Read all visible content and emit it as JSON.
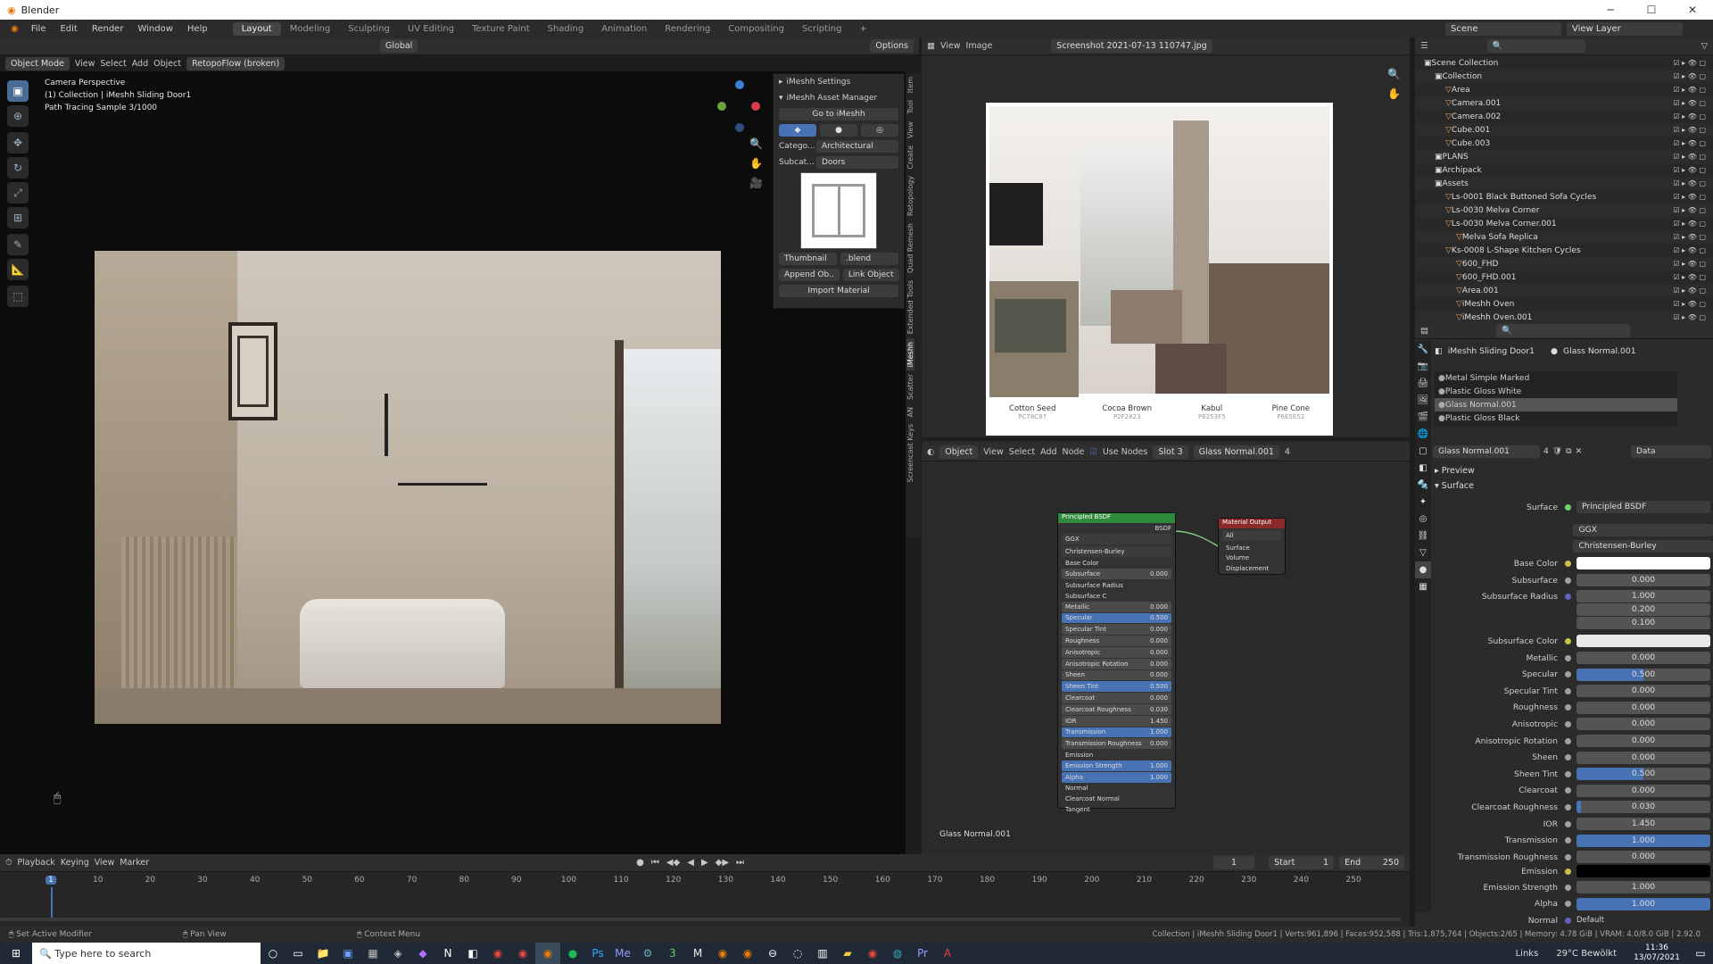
{
  "window": {
    "title": "Blender"
  },
  "menu": {
    "items": [
      "File",
      "Edit",
      "Render",
      "Window",
      "Help"
    ],
    "workspaces": [
      "Layout",
      "Modeling",
      "Sculpting",
      "UV Editing",
      "Texture Paint",
      "Shading",
      "Animation",
      "Rendering",
      "Compositing",
      "Scripting"
    ],
    "active_workspace": "Layout",
    "scene": "Scene",
    "view_layer": "View Layer"
  },
  "viewport": {
    "header": {
      "mode": "Object Mode",
      "menus": [
        "View",
        "Select",
        "Add",
        "Object"
      ],
      "addon": "RetopoFlow (broken)",
      "transform": "Global",
      "options": "Options"
    },
    "overlay": {
      "line1": "Camera Perspective",
      "line2": "(1) Collection | iMeshh Sliding Door1",
      "line3": "Path Tracing Sample 3/1000"
    }
  },
  "imeshh": {
    "settings_label": "iMeshh Settings",
    "manager_label": "iMeshh Asset Manager",
    "goto_label": "Go to iMeshh",
    "category_label": "Catego...",
    "category_value": "Architectural",
    "subcategory_label": "Subcat...",
    "subcategory_value": "Doors",
    "thumbnail_label": "Thumbnail",
    "blend_label": ".blend",
    "append_label": "Append Ob..",
    "link_label": "Link Object",
    "import_label": "Import Material"
  },
  "sidetabs": [
    "Item",
    "Tool",
    "View",
    "Create",
    "Retopology",
    "Quad Remesh",
    "Extended Tools",
    "iMeshh",
    "Scatter",
    "AN",
    "Screencast Keys"
  ],
  "image_editor": {
    "menus": [
      "View",
      "Image"
    ],
    "filename": "Screenshot 2021-07-13 110747.jpg",
    "swatches": [
      {
        "name": "Cotton Seed",
        "code": "PC78C87",
        "color": "#55574c"
      },
      {
        "name": "Cocoa Brown",
        "code": "P2F2823",
        "color": "#8d7b70"
      },
      {
        "name": "Kabul",
        "code": "P6253F5",
        "color": "#5e4d45"
      },
      {
        "name": "Pine Cone",
        "code": "P6E5E52",
        "color": "#6e5e52"
      }
    ]
  },
  "node_editor": {
    "header": {
      "object": "Object",
      "menus": [
        "View",
        "Select",
        "Add",
        "Node"
      ],
      "use_nodes": "Use Nodes",
      "slot": "Slot 3",
      "material": "Glass Normal.001",
      "users": "4"
    },
    "footer_label": "Glass Normal.001",
    "bsdf_title": "Principled BSDF",
    "bsdf_out": "BSDF",
    "dist": "GGX",
    "sss": "Christensen-Burley",
    "output_title": "Material Output",
    "output_target": "All",
    "output_sockets": [
      "Surface",
      "Volume",
      "Displacement"
    ],
    "rows": [
      {
        "label": "Base Color",
        "value": ""
      },
      {
        "label": "Subsurface",
        "value": "0.000"
      },
      {
        "label": "Subsurface Radius",
        "value": ""
      },
      {
        "label": "Subsurface C",
        "value": ""
      },
      {
        "label": "Metallic",
        "value": "0.000"
      },
      {
        "label": "Specular",
        "value": "0.500"
      },
      {
        "label": "Specular Tint",
        "value": "0.000"
      },
      {
        "label": "Roughness",
        "value": "0.000"
      },
      {
        "label": "Anisotropic",
        "value": "0.000"
      },
      {
        "label": "Anisotropic Rotation",
        "value": "0.000"
      },
      {
        "label": "Sheen",
        "value": "0.000"
      },
      {
        "label": "Sheen Tint",
        "value": "0.500"
      },
      {
        "label": "Clearcoat",
        "value": "0.000"
      },
      {
        "label": "Clearcoat Roughness",
        "value": "0.030"
      },
      {
        "label": "IOR",
        "value": "1.450"
      },
      {
        "label": "Transmission",
        "value": "1.000"
      },
      {
        "label": "Transmission Roughness",
        "value": "0.000"
      },
      {
        "label": "Emission",
        "value": ""
      },
      {
        "label": "Emission Strength",
        "value": "1.000"
      },
      {
        "label": "Alpha",
        "value": "1.000"
      },
      {
        "label": "Normal",
        "value": ""
      },
      {
        "label": "Clearcoat Normal",
        "value": ""
      },
      {
        "label": "Tangent",
        "value": ""
      }
    ]
  },
  "outliner": {
    "rows": [
      {
        "label": "Scene Collection",
        "indent": 0
      },
      {
        "label": "Collection",
        "indent": 1
      },
      {
        "label": "Area",
        "indent": 2
      },
      {
        "label": "Camera.001",
        "indent": 2
      },
      {
        "label": "Camera.002",
        "indent": 2
      },
      {
        "label": "Cube.001",
        "indent": 2
      },
      {
        "label": "Cube.003",
        "indent": 2
      },
      {
        "label": "PLANS",
        "indent": 1
      },
      {
        "label": "Archipack",
        "indent": 1
      },
      {
        "label": "Assets",
        "indent": 1
      },
      {
        "label": "Ls-0001 Black Buttoned Sofa Cycles",
        "indent": 2
      },
      {
        "label": "Ls-0030 Melva Corner",
        "indent": 2
      },
      {
        "label": "Ls-0030 Melva Corner.001",
        "indent": 2
      },
      {
        "label": "Melva Sofa Replica",
        "indent": 3
      },
      {
        "label": "Ks-0008 L-Shape Kitchen Cycles",
        "indent": 2
      },
      {
        "label": "600_FHD",
        "indent": 3
      },
      {
        "label": "600_FHD.001",
        "indent": 3
      },
      {
        "label": "Area.001",
        "indent": 3
      },
      {
        "label": "iMeshh Oven",
        "indent": 3
      },
      {
        "label": "iMeshh Oven.001",
        "indent": 3
      }
    ]
  },
  "properties": {
    "object": "iMeshh Sliding Door1",
    "material": "Glass Normal.001",
    "slots": [
      "Metal Simple Marked",
      "Plastic Gloss White",
      "Glass Normal.001",
      "Plastic Gloss Black"
    ],
    "active_slot": 2,
    "mat_field": "Glass Normal.001",
    "mat_users": "4",
    "data_label": "Data",
    "preview_label": "Preview",
    "surface_section": "Surface",
    "surface_label": "Surface",
    "surface_value": "Principled BSDF",
    "dist": "GGX",
    "sss": "Christensen-Burley",
    "base_color_label": "Base Color",
    "subsurface_label": "Subsurface",
    "subsurface_value": "0.000",
    "radius_label": "Subsurface Radius",
    "radius_values": [
      "1.000",
      "0.200",
      "0.100"
    ],
    "sss_color_label": "Subsurface Color",
    "params": [
      {
        "label": "Metallic",
        "value": "0.000",
        "fill": 0
      },
      {
        "label": "Specular",
        "value": "0.500",
        "fill": 0.5
      },
      {
        "label": "Specular Tint",
        "value": "0.000",
        "fill": 0
      },
      {
        "label": "Roughness",
        "value": "0.000",
        "fill": 0
      },
      {
        "label": "Anisotropic",
        "value": "0.000",
        "fill": 0
      },
      {
        "label": "Anisotropic Rotation",
        "value": "0.000",
        "fill": 0
      },
      {
        "label": "Sheen",
        "value": "0.000",
        "fill": 0
      },
      {
        "label": "Sheen Tint",
        "value": "0.500",
        "fill": 0.5
      },
      {
        "label": "Clearcoat",
        "value": "0.000",
        "fill": 0
      },
      {
        "label": "Clearcoat Roughness",
        "value": "0.030",
        "fill": 0.03
      },
      {
        "label": "IOR",
        "value": "1.450",
        "fill": 0
      },
      {
        "label": "Transmission",
        "value": "1.000",
        "fill": 1
      },
      {
        "label": "Transmission Roughness",
        "value": "0.000",
        "fill": 0
      }
    ],
    "emission_label": "Emission",
    "params2": [
      {
        "label": "Emission Strength",
        "value": "1.000",
        "fill": 0
      },
      {
        "label": "Alpha",
        "value": "1.000",
        "fill": 1
      }
    ],
    "normal_label": "Normal",
    "normal_value": "Default"
  },
  "timeline": {
    "menus": [
      "Playback",
      "Keying",
      "View",
      "Marker"
    ],
    "current_frame": "1",
    "start_label": "Start",
    "start": "1",
    "end_label": "End",
    "end": "250",
    "ticks": [
      "1",
      "10",
      "20",
      "30",
      "40",
      "50",
      "60",
      "70",
      "80",
      "90",
      "100",
      "110",
      "120",
      "130",
      "140",
      "150",
      "160",
      "170",
      "180",
      "190",
      "200",
      "210",
      "220",
      "230",
      "240",
      "250"
    ]
  },
  "status": {
    "left": "Set Active Modifier",
    "mid1": "Pan View",
    "mid2": "Context Menu",
    "right": "Collection | iMeshh Sliding Door1 | Verts:961,896 | Faces:952,588 | Tris:1,875,764 | Objects:2/65 | Memory: 4.78 GiB | VRAM: 4.0/8.0 GiB | 2.92.0"
  },
  "taskbar": {
    "search_placeholder": "Type here to search",
    "links": "Links",
    "weather": "29°C  Bewölkt",
    "time": "11:36",
    "date": "13/07/2021"
  }
}
